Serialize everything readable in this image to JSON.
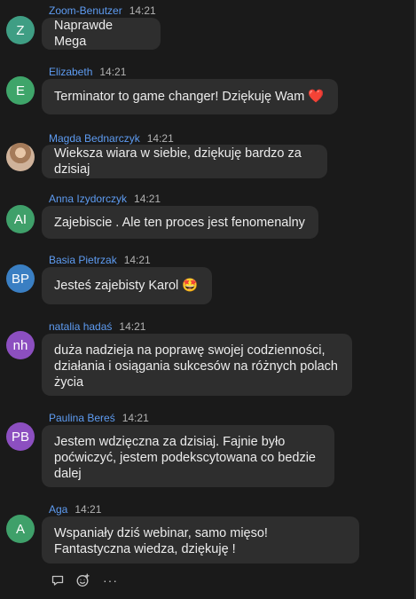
{
  "messages": [
    {
      "initials": "Z",
      "color": "#3f9e84",
      "name": "Zoom-Benutzer",
      "time": "14:21",
      "text": "Naprawde Mega"
    },
    {
      "initials": "E",
      "color": "#3fa56a",
      "name": "Elizabeth",
      "time": "14:21",
      "text": "Terminator to game changer! Dziękuję Wam ❤️"
    },
    {
      "initials": "",
      "color": "",
      "name": "Magda Bednarczyk",
      "time": "14:21",
      "text": "Wieksza wiara w siebie, dziękuję bardzo za dzisiaj",
      "photo": true
    },
    {
      "initials": "AI",
      "color": "#3fa06a",
      "name": "Anna Izydorczyk",
      "time": "14:21",
      "text": "Zajebiscie . Ale ten proces jest fenomenalny"
    },
    {
      "initials": "BP",
      "color": "#3a7fc3",
      "name": "Basia Pietrzak",
      "time": "14:21",
      "text": "Jesteś zajebisty Karol 🤩"
    },
    {
      "initials": "nh",
      "color": "#8c4fc0",
      "name": "natalia hadaś",
      "time": "14:21",
      "text": "duża nadzieja na poprawę swojej codzienności, działania i osiągania sukcesów na różnych polach życia"
    },
    {
      "initials": "PB",
      "color": "#8c4fc0",
      "name": "Paulina Bereś",
      "time": "14:21",
      "text": "Jestem wdzięczna za dzisiaj. Fajnie było poćwiczyć, jestem podekscytowana co bedzie dalej"
    },
    {
      "initials": "A",
      "color": "#3fa06a",
      "name": "Aga",
      "time": "14:21",
      "text": "Wspaniały dziś webinar, samo mięso! Fantastyczna wiedza, dziękuję !"
    }
  ],
  "actions": {
    "reply_icon": "reply-icon",
    "emoji_icon": "add-reaction-icon",
    "more": "···"
  }
}
